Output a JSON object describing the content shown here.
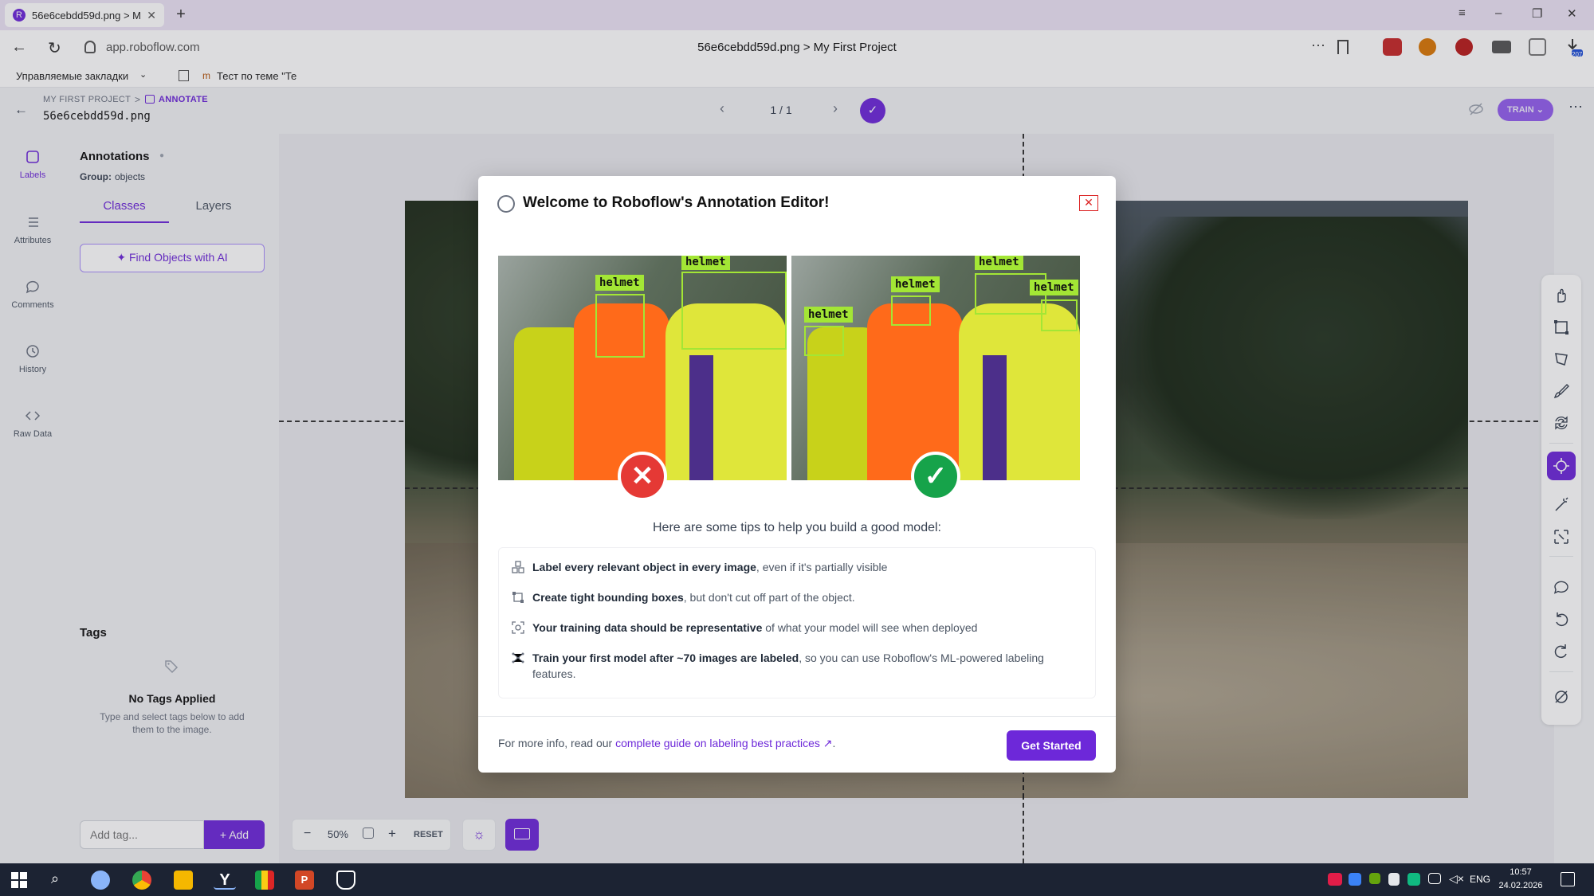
{
  "browser": {
    "tab_title": "56e6cebdd59d.png > M",
    "url": "app.roboflow.com",
    "page_title": "56e6cebdd59d.png > My First Project",
    "bookmarks_folder": "Управляемые закладки",
    "bookmark_item": "Тест по теме \"Те",
    "download_badge": "207"
  },
  "header": {
    "breadcrumb_project": "MY FIRST PROJECT",
    "breadcrumb_sep": ">",
    "breadcrumb_current": "ANNOTATE",
    "filename": "56e6cebdd59d.png",
    "pager": "1 / 1",
    "train_label": "TRAIN"
  },
  "rail": {
    "items": [
      {
        "label": "Labels"
      },
      {
        "label": "Attributes"
      },
      {
        "label": "Comments"
      },
      {
        "label": "History"
      },
      {
        "label": "Raw Data"
      }
    ]
  },
  "panel": {
    "title": "Annotations",
    "group_label": "Group:",
    "group_value": "objects",
    "tabs": [
      "Classes",
      "Layers"
    ],
    "find_ai_label": "Find Objects with AI",
    "tags_title": "Tags",
    "no_tags_title": "No Tags Applied",
    "no_tags_desc": "Type and select tags below to add them to the image.",
    "add_tag_placeholder": "Add tag...",
    "add_button": "Add"
  },
  "zoom": {
    "level": "50%",
    "reset_label": "RESET"
  },
  "modal": {
    "title": "Welcome to Roboflow's Annotation Editor!",
    "box_label": "helmet",
    "tips_heading": "Here are some tips to help you build a good model:",
    "tips": [
      {
        "bold": "Label every relevant object in every image",
        "rest": ", even if it's partially visible"
      },
      {
        "bold": "Create tight bounding boxes",
        "rest": ", but don't cut off part of the object."
      },
      {
        "bold": "Your training data should be representative",
        "rest": " of what your model will see when deployed"
      },
      {
        "bold": "Train your first model after ~70 images are labeled",
        "rest": ", so you can use Roboflow's ML-powered labeling features."
      }
    ],
    "footer_text": "For more info, read our ",
    "footer_link": "complete guide on labeling best practices",
    "footer_end": ".",
    "cta": "Get Started"
  },
  "taskbar": {
    "lang": "ENG",
    "time": "10:57",
    "date": "24.02.2026"
  },
  "colors": {
    "accent": "#6d28d9",
    "box_green": "#a3e635",
    "bad_red": "#e53935",
    "good_green": "#16a34a"
  }
}
